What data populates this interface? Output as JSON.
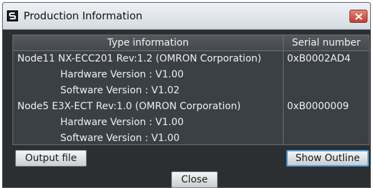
{
  "window": {
    "title": "Production Information"
  },
  "table": {
    "headers": {
      "type": "Type information",
      "serial": "Serial number"
    },
    "rows": [
      {
        "type": "Node11 NX-ECC201 Rev:1.2 (OMRON Corporation)",
        "serial": "0xB0002AD4"
      },
      {
        "type": "Hardware Version : V1.00",
        "serial": ""
      },
      {
        "type": "Software Version : V1.02",
        "serial": ""
      },
      {
        "type": "Node5 E3X-ECT Rev:1.0 (OMRON Corporation)",
        "serial": "0xB0000009"
      },
      {
        "type": "Hardware Version : V1.00",
        "serial": ""
      },
      {
        "type": "Software Version : V1.00",
        "serial": ""
      }
    ]
  },
  "buttons": {
    "output_file": "Output file",
    "show_outline": "Show Outline",
    "close": "Close"
  },
  "icons": {
    "app": "application-icon",
    "close": "close-icon"
  },
  "colors": {
    "window_background": "#2b2f32",
    "grid_background": "#3b4045",
    "close_button": "#c2402f",
    "focus_outline": "#4f9bd8"
  }
}
